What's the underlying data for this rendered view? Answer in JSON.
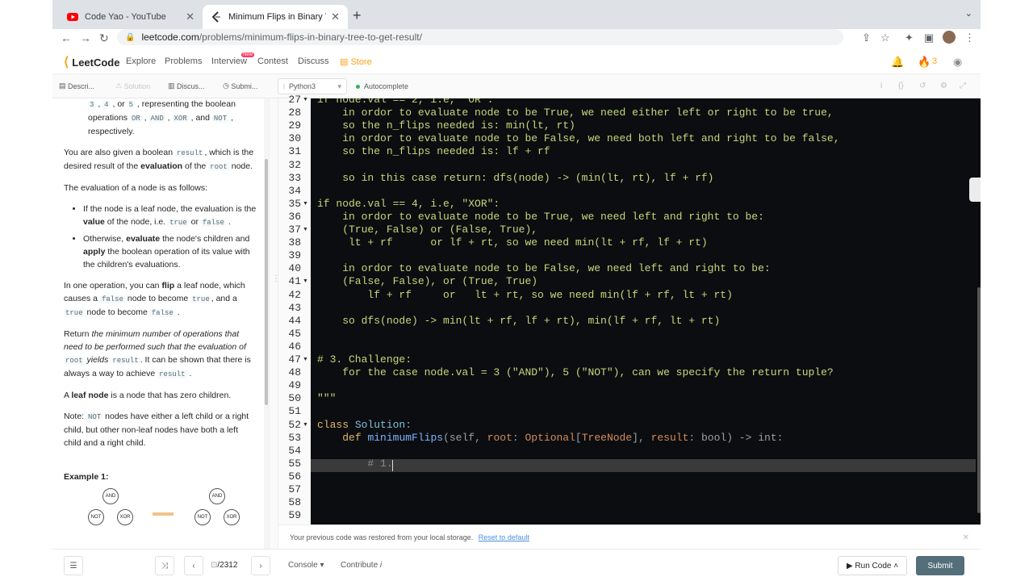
{
  "browser": {
    "tabs": [
      {
        "title": "Code Yao - YouTube",
        "favicon": "youtube-icon"
      },
      {
        "title": "Minimum Flips in Binary Tree to",
        "favicon": "leetcode-icon"
      }
    ],
    "url_host": "leetcode.com",
    "url_path": "/problems/minimum-flips-in-binary-tree-to-get-result/"
  },
  "header": {
    "logo_text": "LeetCode",
    "menu": [
      "Explore",
      "Problems",
      "Interview",
      "Contest",
      "Discuss",
      "Store"
    ],
    "new_badge": "New",
    "streak": "3"
  },
  "subtabs": {
    "description": "Descri...",
    "solution": "Solution",
    "discuss": "Discus...",
    "submissions": "Submi...",
    "language": "Python3",
    "autocomplete": "Autocomplete"
  },
  "description": {
    "p_ops_cont": ", or , representing the boolean operations , , and , respectively.",
    "p_result_a": "You are also given a boolean",
    "p_result_b": ", which is the desired result of the",
    "p_result_bold": "evaluation",
    "p_result_c": "of the",
    "p_result_d": "node.",
    "eval_intro": "The evaluation of a node is as follows:",
    "code_tokens": {
      "n3": "3",
      "n4": "4",
      "n5": "5",
      "or": "OR",
      "and": "AND",
      "xor": "XOR",
      "not": "NOT",
      "result": "result",
      "root": "root",
      "true": "true",
      "false": "false"
    },
    "li1_a": "If the node is a leaf node, the evaluation is the",
    "li1_bold": "value",
    "li1_b": "of the node, i.e.",
    "li1_c": "or",
    "li2_a": "Otherwise,",
    "li2_bold1": "evaluate",
    "li2_b": "the node's children and",
    "li2_bold2": "apply",
    "li2_c": "the boolean operation of its value with the children's evaluations.",
    "flip_a": "In one operation, you can",
    "flip_bold": "flip",
    "flip_b": "a leaf node, which causes a",
    "flip_c": "node to become",
    "flip_d": ", and a",
    "flip_e": "node to become",
    "ret_a": "Return",
    "ret_it": "the minimum number of operations that need to be performed such that the evaluation of",
    "ret_it2": "yields",
    "ret_b": ". It can be shown that there is always a way to achieve",
    "leaf_a": "A",
    "leaf_bold": "leaf node",
    "leaf_b": "is a node that has zero children.",
    "note_a": "Note:",
    "note_b": "nodes have either a left child or a right child, but other non-leaf nodes have both a left child and a right child.",
    "example_title": "Example 1:",
    "tree_nodes": [
      "AND",
      "NOT",
      "XOR",
      "AND",
      "NOT",
      "XOR"
    ]
  },
  "editor": {
    "lines": [
      {
        "n": "27",
        "fold": true,
        "text": "if node.val == 2, i.e, \"OR\":"
      },
      {
        "n": "28",
        "fold": false,
        "text": "    in ordor to evaluate node to be True, we need either left or right to be true,"
      },
      {
        "n": "29",
        "fold": false,
        "text": "    so the n_flips needed is: min(lt, rt)"
      },
      {
        "n": "30",
        "fold": false,
        "text": "    in ordor to evaluate node to be False, we need both left and right to be false,"
      },
      {
        "n": "31",
        "fold": false,
        "text": "    so the n_flips needed is: lf + rf"
      },
      {
        "n": "32",
        "fold": false,
        "text": ""
      },
      {
        "n": "33",
        "fold": false,
        "text": "    so in this case return: dfs(node) -> (min(lt, rt), lf + rf)"
      },
      {
        "n": "34",
        "fold": false,
        "text": ""
      },
      {
        "n": "35",
        "fold": true,
        "text": "if node.val == 4, i.e, \"XOR\":"
      },
      {
        "n": "36",
        "fold": false,
        "text": "    in ordor to evaluate node to be True, we need left and right to be:"
      },
      {
        "n": "37",
        "fold": true,
        "text": "    (True, False) or (False, True),"
      },
      {
        "n": "38",
        "fold": false,
        "text": "     lt + rf      or lf + rt, so we need min(lt + rf, lf + rt)"
      },
      {
        "n": "39",
        "fold": false,
        "text": ""
      },
      {
        "n": "40",
        "fold": false,
        "text": "    in ordor to evaluate node to be False, we need left and right to be:"
      },
      {
        "n": "41",
        "fold": true,
        "text": "    (False, False), or (True, True)"
      },
      {
        "n": "42",
        "fold": false,
        "text": "        lf + rf     or   lt + rt, so we need min(lf + rf, lt + rt)"
      },
      {
        "n": "43",
        "fold": false,
        "text": ""
      },
      {
        "n": "44",
        "fold": false,
        "text": "    so dfs(node) -> min(lt + rf, lf + rt), min(lf + rf, lt + rt)"
      },
      {
        "n": "45",
        "fold": false,
        "text": ""
      },
      {
        "n": "46",
        "fold": false,
        "text": ""
      },
      {
        "n": "47",
        "fold": true,
        "text": "# 3. Challenge:"
      },
      {
        "n": "48",
        "fold": false,
        "text": "    for the case node.val = 3 (\"AND\"), 5 (\"NOT\"), can we specify the return tuple?"
      },
      {
        "n": "49",
        "fold": false,
        "text": ""
      },
      {
        "n": "50",
        "fold": false,
        "text": "\"\"\""
      },
      {
        "n": "51",
        "fold": false,
        "text": ""
      },
      {
        "n": "52",
        "fold": true,
        "text": ""
      },
      {
        "n": "53",
        "fold": false,
        "text": ""
      },
      {
        "n": "54",
        "fold": false,
        "text": ""
      },
      {
        "n": "55",
        "fold": false,
        "text": "        # 1."
      },
      {
        "n": "56",
        "fold": false,
        "text": ""
      },
      {
        "n": "57",
        "fold": false,
        "text": ""
      },
      {
        "n": "58",
        "fold": false,
        "text": ""
      },
      {
        "n": "59",
        "fold": false,
        "text": ""
      }
    ],
    "class_kw": "class",
    "class_name": "Solution",
    "def_kw": "def",
    "def_name": "minimumFlips",
    "def_self": "(self, ",
    "arg_root": "root",
    "arg_root_type1": "Optional",
    "arg_root_type2": "TreeNode",
    "arg_result": "result",
    "arg_result_type": "bool",
    "ret_type": "int"
  },
  "notice": {
    "text": "Your previous code was restored from your local storage.",
    "link": "Reset to default"
  },
  "bottom": {
    "pager": "/2312",
    "console": "Console",
    "contribute": "Contribute",
    "run": "Run Code",
    "submit": "Submit"
  }
}
